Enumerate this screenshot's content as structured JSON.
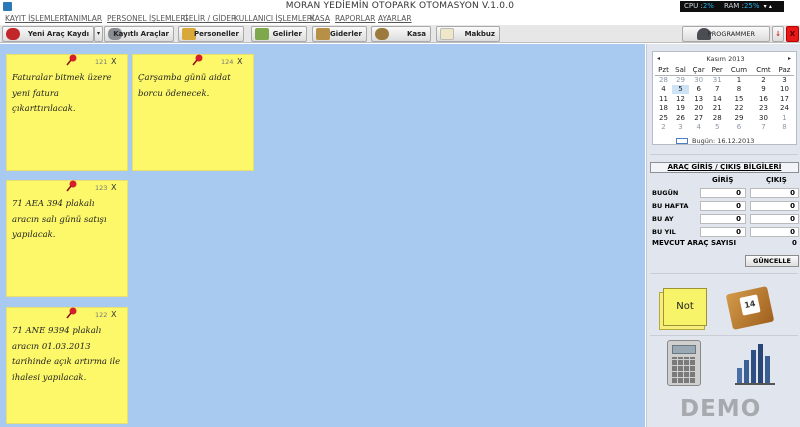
{
  "window": {
    "title": "MORAN YEDİEMİN OTOPARK OTOMASYON V.1.0.0",
    "sysmon": {
      "cpu_label": "CPU :",
      "cpu_value": "2%",
      "ram_label": "RAM :",
      "ram_value": "25%"
    }
  },
  "menu": [
    "KAYIT İŞLEMLERİ",
    "TANIMLAR",
    "PERSONEL İŞLEMLERİ",
    "GELİR / GİDER",
    "KULLANICI İŞLEMLERİ",
    "KASA",
    "RAPORLAR",
    "AYARLAR"
  ],
  "toolbar": {
    "buttons": [
      "Yeni Araç Kaydı",
      "Kayıtlı Araçlar",
      "Personeller",
      "Gelirler",
      "Giderler",
      "Kasa",
      "Makbuz"
    ],
    "programmer": "PROGRAMMER",
    "close": "X"
  },
  "notes": [
    {
      "id": "121",
      "text": "Faturalar bitmek üzere yeni fatura çıkarttırılacak.",
      "close": "X"
    },
    {
      "id": "124",
      "text": "Çarşamba günü aidat borcu ödenecek.",
      "close": "X"
    },
    {
      "id": "123",
      "text": "71 AEA 394 plakalı aracın salı günü satışı yapılacak.",
      "close": "X"
    },
    {
      "id": "122",
      "text": "71 ANE 9394 plakalı aracın 01.03.2013 tarihinde açık artırma ile ihalesi yapılacak.",
      "close": "X"
    }
  ],
  "calendar": {
    "month": "Kasım 2013",
    "prev": "◂",
    "next": "▸",
    "weekdays": [
      "Pzt",
      "Sal",
      "Çar",
      "Per",
      "Cum",
      "Cmt",
      "Paz"
    ],
    "weeks": [
      [
        "28",
        "29",
        "30",
        "31",
        "1",
        "2",
        "3"
      ],
      [
        "4",
        "5",
        "6",
        "7",
        "8",
        "9",
        "10"
      ],
      [
        "11",
        "12",
        "13",
        "14",
        "15",
        "16",
        "17"
      ],
      [
        "18",
        "19",
        "20",
        "21",
        "22",
        "23",
        "24"
      ],
      [
        "25",
        "26",
        "27",
        "28",
        "29",
        "30",
        "1"
      ],
      [
        "2",
        "3",
        "4",
        "5",
        "6",
        "7",
        "8"
      ]
    ],
    "today": "Bugün: 16.12.2013"
  },
  "arac": {
    "title": "ARAÇ GİRİŞ / ÇIKIŞ BİLGİLERİ",
    "col_in": "GİRİŞ",
    "col_out": "ÇIKIŞ",
    "rows": [
      {
        "label": "BUGÜN",
        "in": "0",
        "out": "0"
      },
      {
        "label": "BU HAFTA",
        "in": "0",
        "out": "0"
      },
      {
        "label": "BU AY",
        "in": "0",
        "out": "0"
      },
      {
        "label": "BU YIL",
        "in": "0",
        "out": "0"
      }
    ],
    "mevcut_label": "MEVCUT ARAÇ SAYISI",
    "mevcut_value": "0",
    "refresh": "GÜNCELLE"
  },
  "tiles": {
    "note": "Not",
    "calendar_day": "14"
  },
  "demo": "DEMO"
}
